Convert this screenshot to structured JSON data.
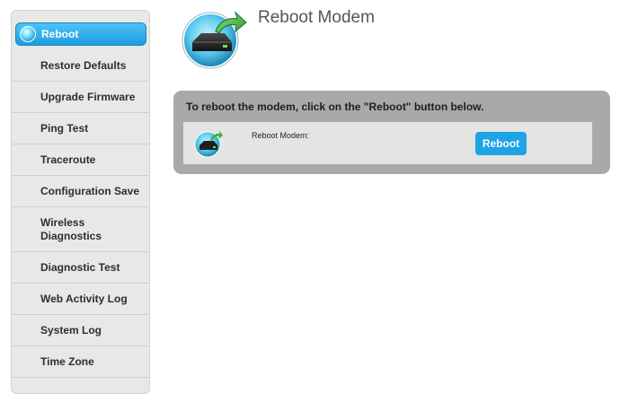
{
  "sidebar": {
    "items": [
      {
        "label": "Reboot",
        "active": true
      },
      {
        "label": "Restore Defaults"
      },
      {
        "label": "Upgrade Firmware"
      },
      {
        "label": "Ping Test"
      },
      {
        "label": "Traceroute"
      },
      {
        "label": "Configuration Save"
      },
      {
        "label": "Wireless Diagnostics"
      },
      {
        "label": "Diagnostic Test"
      },
      {
        "label": "Web Activity Log"
      },
      {
        "label": "System Log"
      },
      {
        "label": "Time Zone"
      }
    ]
  },
  "header": {
    "title": "Reboot Modem",
    "icon": "modem-reboot-icon"
  },
  "panel": {
    "instruction": "To reboot the modem, click on the \"Reboot\" button below.",
    "row_label": "Reboot Modem:",
    "button_label": "Reboot",
    "row_icon": "modem-reboot-icon"
  },
  "colors": {
    "accent": "#1da3e6",
    "panel_bg": "#a9a9a9",
    "sidebar_bg": "#e8e8e6"
  }
}
